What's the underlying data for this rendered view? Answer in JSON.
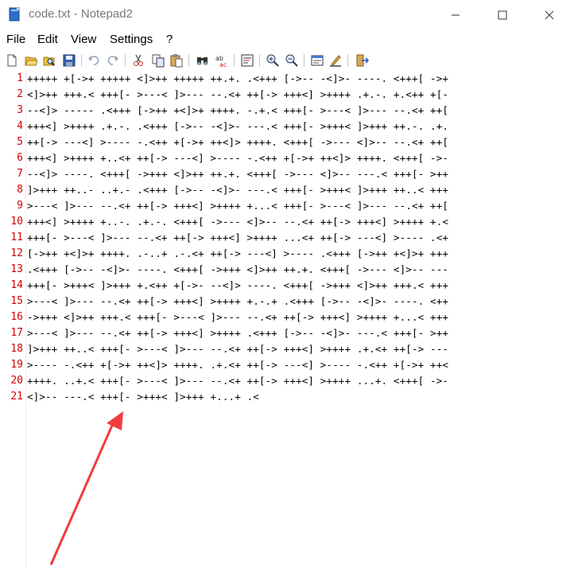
{
  "window": {
    "title": "code.txt - Notepad2",
    "controls": [
      "minimize-icon",
      "maximize-icon",
      "close-icon"
    ]
  },
  "menu": [
    "File",
    "Edit",
    "View",
    "Settings",
    "?"
  ],
  "toolbar": {
    "icons": [
      "new-file-icon",
      "open-folder-icon",
      "browse-icon",
      "save-icon",
      "undo-icon",
      "redo-icon",
      "cut-icon",
      "copy-icon",
      "paste-icon",
      "find-icon",
      "replace-icon",
      "word-wrap-icon",
      "zoom-in-icon",
      "zoom-out-icon",
      "scheme-icon",
      "customize-icon",
      "exit-icon"
    ]
  },
  "editor": {
    "line_numbers": [
      "1",
      "2",
      "3",
      "4",
      "5",
      "6",
      "7",
      "8",
      "9",
      "10",
      "11",
      "12",
      "13",
      "14",
      "15",
      "16",
      "17",
      "18",
      "19",
      "20",
      "21"
    ],
    "lines": [
      "+++++ +[->+ +++++ <]>++ +++++ ++.+. .<+++ [->-- -<]>- ----. <+++[ ->+",
      "<]>++ +++.< +++[- >---< ]>--- --.<+ ++[-> +++<] >++++ .+.-. +.<++ +[-",
      "--<]> ----- .<+++ [->++ +<]>+ ++++. -.+.< +++[- >---< ]>--- --.<+ ++[",
      "+++<] >++++ .+.-. .<+++ [->-- -<]>- ---.< +++[- >+++< ]>+++ ++.-. .+.",
      "++[-> ---<] >---- -.<++ +[->+ ++<]> ++++. <+++[ ->--- <]>-- --.<+ ++[",
      "+++<] >++++ +..<+ ++[-> ---<] >---- -.<++ +[->+ ++<]> ++++. <+++[ ->-",
      "--<]> ----. <+++[ ->+++ <]>++ ++.+. <+++[ ->--- <]>-- ---.< +++[- >++",
      "]>+++ ++..- ..+.- .<+++ [->-- -<]>- ---.< +++[- >+++< ]>+++ ++..< +++",
      ">---< ]>--- --.<+ ++[-> +++<] >++++ +...< +++[- >---< ]>--- --.<+ ++[",
      "+++<] >++++ +..-. .+.-. <+++[ ->--- <]>-- --.<+ ++[-> +++<] >++++ +.<",
      "+++[- >---< ]>--- --.<+ ++[-> +++<] >++++ ...<+ ++[-> ---<] >---- .<+",
      "[->++ +<]>+ ++++. .-..+ .-.<+ ++[-> ---<] >---- .<+++ [->++ +<]>+ +++",
      ".<+++ [->-- -<]>- ----. <+++[ ->+++ <]>++ ++.+. <+++[ ->--- <]>-- ---",
      "+++[- >+++< ]>+++ +.<++ +[->- --<]> ----. <+++[ ->+++ <]>++ +++.< +++",
      ">---< ]>--- --.<+ ++[-> +++<] >++++ +.-.+ .<+++ [->-- -<]>- ----. <++",
      "->+++ <]>++ +++.< +++[- >---< ]>--- --.<+ ++[-> +++<] >++++ +...< +++",
      ">---< ]>--- --.<+ ++[-> +++<] >++++ .<+++ [->-- -<]>- ---.< +++[- >++",
      "]>+++ ++..< +++[- >---< ]>--- --.<+ ++[-> +++<] >++++ .+.<+ ++[-> ---",
      ">---- -.<++ +[->+ ++<]> ++++. .+.<+ ++[-> ---<] >---- -.<++ +[->+ ++<",
      "++++. ..+.< +++[- >---< ]>--- --.<+ ++[-> +++<] >++++ ...+. <+++[ ->-",
      "<]>-- ---.< +++[- >+++< ]>+++ +...+ .<"
    ]
  },
  "colors": {
    "line_number": "#d60000",
    "annotation_arrow": "#f03c3c"
  }
}
